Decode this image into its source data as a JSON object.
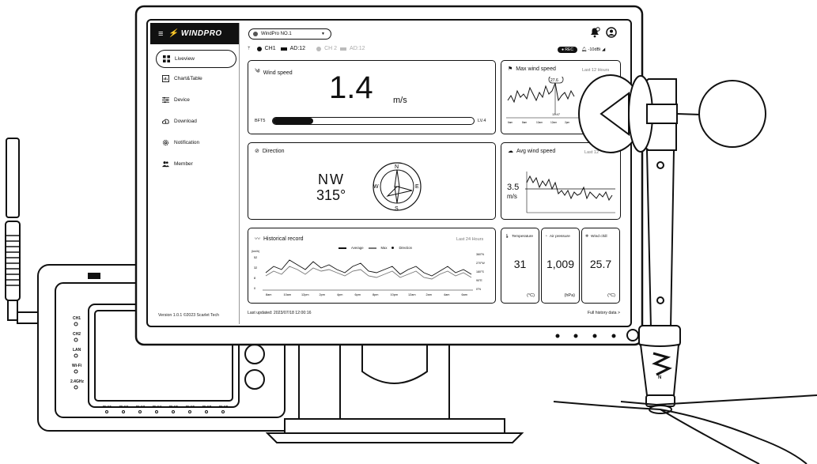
{
  "brand": {
    "name": "WINDPRO"
  },
  "sidebar": {
    "items": [
      {
        "label": "Liveview",
        "icon": "dashboard-icon",
        "active": true
      },
      {
        "label": "Chart&Table",
        "icon": "chart-icon",
        "active": false
      },
      {
        "label": "Device",
        "icon": "sliders-icon",
        "active": false
      },
      {
        "label": "Download",
        "icon": "cloud-download-icon",
        "active": false
      },
      {
        "label": "Notification",
        "icon": "gear-icon",
        "active": false
      },
      {
        "label": "Member",
        "icon": "users-icon",
        "active": false
      }
    ],
    "version": "Version 1.0.1 ©2023 Scarlet Tech"
  },
  "header": {
    "device_select": "WindPro NO.1",
    "ch1": "CH1",
    "ad1": "AD:12",
    "ch2": "CH 2",
    "ad2": "AD:12",
    "rec": "REC",
    "signal": "-10dBi"
  },
  "wind_speed": {
    "title": "Wind speed",
    "value": "1.4",
    "unit": "m/s",
    "bft_label": "BFT5",
    "level": "LV.4",
    "bar_fraction": 0.2
  },
  "max_wind": {
    "title": "Max wind speed",
    "period": "Last 12 Hours",
    "peak": "27.6",
    "time": "13:47",
    "x_ticks": [
      "6am",
      "8am",
      "10am",
      "12am",
      "2pm",
      "3pm"
    ]
  },
  "direction": {
    "title": "Direction",
    "cardinal": "NW",
    "degrees": "315°",
    "compass": {
      "n": "N",
      "e": "E",
      "s": "S",
      "w": "W"
    }
  },
  "avg_wind": {
    "title": "Avg wind speed",
    "period": "Last 12",
    "value": "3.5",
    "unit": "m/s"
  },
  "historical": {
    "title": "Historical record",
    "period": "Last 24 Hours",
    "legend": [
      "Average",
      "Max",
      "Direction"
    ],
    "y_unit": "(km/h)",
    "y_ticks": [
      "52",
      "32",
      "8",
      "0"
    ],
    "y_right": [
      "360°N",
      "270°W",
      "180°S",
      "90°E",
      "0°N"
    ],
    "x_ticks": [
      "8am",
      "10am",
      "12pm",
      "2pm",
      "4pm",
      "6pm",
      "8pm",
      "10pm",
      "12am",
      "2am",
      "4am",
      "6am"
    ]
  },
  "metrics": [
    {
      "label": "Temperature",
      "value": "31",
      "unit": "(°C)",
      "icon": "thermometer-icon"
    },
    {
      "label": "Air pressure",
      "value": "1,009",
      "unit": "(hPa)",
      "icon": "gauge-icon"
    },
    {
      "label": "Wind chill",
      "value": "25.7",
      "unit": "(°C)",
      "icon": "wind-chill-icon"
    }
  ],
  "footer": {
    "updated": "Last updated: 2023/07/18 12:00:16",
    "link": "Full history data >"
  },
  "hardware": {
    "labels": [
      "CH1",
      "CH2",
      "LAN",
      "Wi-Fi",
      "2.4GHz"
    ],
    "relays": [
      "RLY1",
      "RLY2",
      "RLY3",
      "RLY4",
      "RLY5",
      "RLY6",
      "RLY7",
      "RLY8"
    ],
    "logo_letter": "N"
  },
  "colors": {
    "ink": "#111111",
    "muted": "#777777",
    "bg": "#ffffff"
  }
}
